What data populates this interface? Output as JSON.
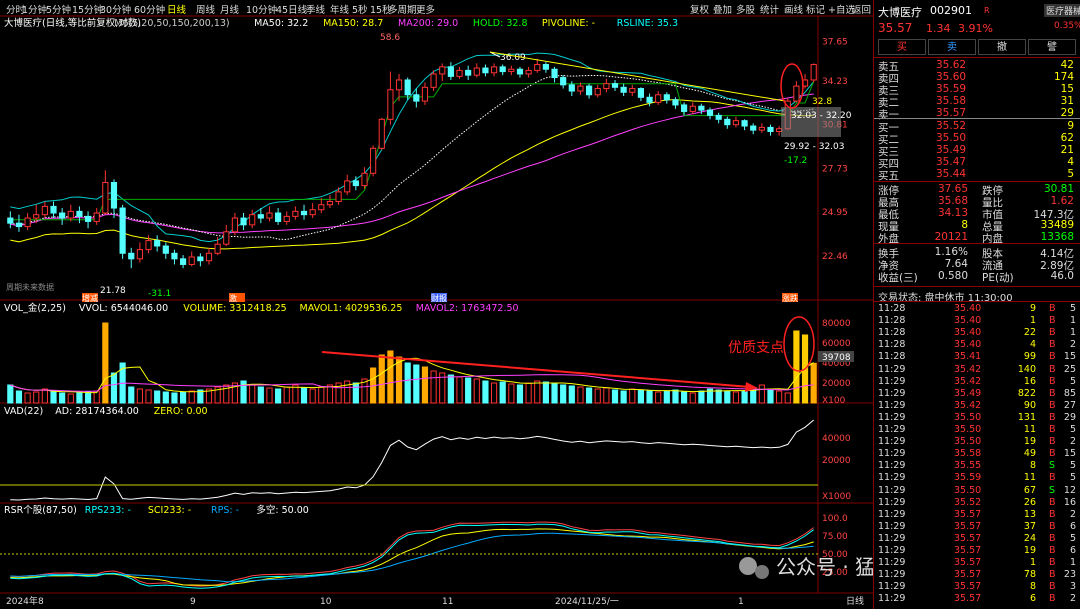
{
  "toolbar": {
    "periods": [
      "分时",
      "1分钟",
      "5分钟",
      "15分钟",
      "30分钟",
      "60分钟",
      "日线",
      "周线",
      "月线",
      "10分钟",
      "45日线",
      "季线",
      "年线",
      "5秒",
      "15秒",
      "多周期",
      "更多"
    ],
    "active_period": "日线",
    "tools": [
      "复权",
      "叠加",
      "多股",
      "统计",
      "画线",
      "标记",
      "+自选",
      "返回"
    ]
  },
  "main_panel": {
    "legend": [
      {
        "text": "大博医疗(日线,等比前复权,对数)",
        "color": "#ffffff"
      },
      {
        "text": "M6(5,20,50,150,200,13)",
        "color": "#cccccc"
      },
      {
        "text": "MA50: 32.2",
        "color": "#ffffff"
      },
      {
        "text": "MA150: 28.7",
        "color": "#ffff00"
      },
      {
        "text": "MA200: 29.0",
        "color": "#ff40ff"
      },
      {
        "text": "HOLD: 32.8",
        "color": "#00ff00"
      },
      {
        "text": "PIVOLINE: -",
        "color": "#ffff00"
      },
      {
        "text": "RSLINE: 35.3",
        "color": "#00ffff"
      }
    ],
    "price_axis": [
      "37.65",
      "34.23",
      "30.81",
      "27.73",
      "24.95",
      "22.46"
    ],
    "annotations": {
      "high": "58.6",
      "peak": "36.09",
      "low": "21.78",
      "low_mark": "-31.1",
      "hold_level": "32.8",
      "box_upper": "32.03 - 32.20",
      "box_lower": "29.92 - 32.03",
      "recent_low_mark": "-17.2",
      "note": "周期未来数据"
    },
    "event_tags": [
      "增减",
      "激",
      "财报",
      "涨跌"
    ]
  },
  "vol_panel": {
    "legend": [
      {
        "text": "VOL_金(2,25)",
        "color": "#ffffff"
      },
      {
        "text": "VVOL: 6544046.00",
        "color": "#ffffff"
      },
      {
        "text": "VOLUME: 3312418.25",
        "color": "#ffff00"
      },
      {
        "text": "MAVOL1: 4029536.25",
        "color": "#ffff00"
      },
      {
        "text": "MAVOL2: 1763472.50",
        "color": "#ff40ff"
      }
    ],
    "axis": [
      "80000",
      "60000",
      "40000",
      "20000",
      "X100"
    ],
    "current_value": "39708",
    "annotation": "优质支点"
  },
  "vad_panel": {
    "legend": [
      {
        "text": "VAD(22)",
        "color": "#ffffff"
      },
      {
        "text": "AD: 28174364.00",
        "color": "#ffffff"
      },
      {
        "text": "ZERO: 0.00",
        "color": "#ffff00"
      }
    ],
    "axis": [
      "40000",
      "20000",
      "X1000"
    ]
  },
  "rsr_panel": {
    "legend": [
      {
        "text": "RSR个股(87,50)",
        "color": "#ffffff"
      },
      {
        "text": "RPS233: -",
        "color": "#00ffff"
      },
      {
        "text": "SCI233: -",
        "color": "#ffff00"
      },
      {
        "text": "RPS: -",
        "color": "#00aaff"
      },
      {
        "text": "多空: 50.00",
        "color": "#ffffff"
      }
    ],
    "axis": [
      "100.0",
      "75.00",
      "50.00",
      "25.00"
    ]
  },
  "x_axis": {
    "labels": [
      "2024年",
      "8",
      "9",
      "10",
      "11",
      "2024/11/25/一",
      "1"
    ],
    "right_label": "日线"
  },
  "watermark": "公众号 · 猛兽派选股",
  "quote": {
    "name": "大博医疗",
    "code": "002901",
    "tag": "R",
    "sector": "医疗器械",
    "sector_change": "0.35%",
    "price": "35.57",
    "change": "1.34",
    "change_pct": "3.91%",
    "buttons": [
      "买",
      "卖",
      "撤",
      "譬"
    ],
    "asks": [
      {
        "label": "卖五",
        "price": "35.62",
        "vol": "42"
      },
      {
        "label": "卖四",
        "price": "35.60",
        "vol": "174"
      },
      {
        "label": "卖三",
        "price": "35.59",
        "vol": "15"
      },
      {
        "label": "卖二",
        "price": "35.58",
        "vol": "31"
      },
      {
        "label": "卖一",
        "price": "35.57",
        "vol": "29"
      }
    ],
    "bids": [
      {
        "label": "买一",
        "price": "35.52",
        "vol": "9"
      },
      {
        "label": "买二",
        "price": "35.50",
        "vol": "62"
      },
      {
        "label": "买三",
        "price": "35.49",
        "vol": "21"
      },
      {
        "label": "买四",
        "price": "35.47",
        "vol": "4"
      },
      {
        "label": "买五",
        "price": "35.44",
        "vol": "5"
      }
    ],
    "stats": [
      {
        "l1": "涨停",
        "v1": "37.65",
        "c1": "#ff3333",
        "l2": "跌停",
        "v2": "30.81",
        "c2": "#00ff00"
      },
      {
        "l1": "最高",
        "v1": "35.68",
        "c1": "#ff3333",
        "l2": "量比",
        "v2": "1.62",
        "c2": "#ff3333"
      },
      {
        "l1": "最低",
        "v1": "34.13",
        "c1": "#ff3333",
        "l2": "市值",
        "v2": "147.3亿",
        "c2": "#dddddd"
      },
      {
        "l1": "现量",
        "v1": "8",
        "c1": "#ffff00",
        "l2": "总量",
        "v2": "33489",
        "c2": "#ffff00"
      },
      {
        "l1": "外盘",
        "v1": "20121",
        "c1": "#ff3333",
        "l2": "内盘",
        "v2": "13368",
        "c2": "#00ff00"
      }
    ],
    "stats2": [
      {
        "l1": "换手",
        "v1": "1.16%",
        "l2": "股本",
        "v2": "4.14亿"
      },
      {
        "l1": "净资",
        "v1": "7.64",
        "l2": "流通",
        "v2": "2.89亿"
      },
      {
        "l1": "收益(三)",
        "v1": "0.580",
        "l2": "PE(动)",
        "v2": "46.0"
      }
    ],
    "status": "交易状态: 盘中休市 11:30:00"
  },
  "ticks": [
    {
      "t": "11:28",
      "p": "35.40",
      "v": "9",
      "s": "B",
      "n": "5"
    },
    {
      "t": "11:28",
      "p": "35.40",
      "v": "1",
      "s": "B",
      "n": "1"
    },
    {
      "t": "11:28",
      "p": "35.40",
      "v": "22",
      "s": "B",
      "n": "1"
    },
    {
      "t": "11:28",
      "p": "35.40",
      "v": "4",
      "s": "B",
      "n": "2"
    },
    {
      "t": "11:28",
      "p": "35.41",
      "v": "99",
      "s": "B",
      "n": "15"
    },
    {
      "t": "11:29",
      "p": "35.42",
      "v": "140",
      "s": "B",
      "n": "25"
    },
    {
      "t": "11:29",
      "p": "35.42",
      "v": "16",
      "s": "B",
      "n": "5"
    },
    {
      "t": "11:29",
      "p": "35.49",
      "v": "822",
      "s": "B",
      "n": "85"
    },
    {
      "t": "11:29",
      "p": "35.42",
      "v": "90",
      "s": "B",
      "n": "27"
    },
    {
      "t": "11:29",
      "p": "35.50",
      "v": "131",
      "s": "B",
      "n": "29"
    },
    {
      "t": "11:29",
      "p": "35.50",
      "v": "11",
      "s": "B",
      "n": "5"
    },
    {
      "t": "11:29",
      "p": "35.50",
      "v": "19",
      "s": "B",
      "n": "2"
    },
    {
      "t": "11:29",
      "p": "35.58",
      "v": "49",
      "s": "B",
      "n": "15"
    },
    {
      "t": "11:29",
      "p": "35.55",
      "v": "8",
      "s": "S",
      "n": "5"
    },
    {
      "t": "11:29",
      "p": "35.59",
      "v": "11",
      "s": "B",
      "n": "5"
    },
    {
      "t": "11:29",
      "p": "35.50",
      "v": "67",
      "s": "S",
      "n": "12"
    },
    {
      "t": "11:29",
      "p": "35.52",
      "v": "26",
      "s": "B",
      "n": "16"
    },
    {
      "t": "11:29",
      "p": "35.57",
      "v": "13",
      "s": "B",
      "n": "2"
    },
    {
      "t": "11:29",
      "p": "35.57",
      "v": "37",
      "s": "B",
      "n": "6"
    },
    {
      "t": "11:29",
      "p": "35.57",
      "v": "24",
      "s": "B",
      "n": "5"
    },
    {
      "t": "11:29",
      "p": "35.57",
      "v": "19",
      "s": "B",
      "n": "6"
    },
    {
      "t": "11:29",
      "p": "35.57",
      "v": "1",
      "s": "B",
      "n": "1"
    },
    {
      "t": "11:29",
      "p": "35.57",
      "v": "78",
      "s": "B",
      "n": "23"
    },
    {
      "t": "11:29",
      "p": "35.57",
      "v": "8",
      "s": "B",
      "n": "3"
    },
    {
      "t": "11:29",
      "p": "35.57",
      "v": "6",
      "s": "B",
      "n": "2"
    }
  ],
  "chart_data": {
    "type": "candlestick",
    "title": "大博医疗(日线,等比前复权,对数)",
    "x_labels": [
      "2024年",
      "8",
      "9",
      "10",
      "11",
      "2024/11/25/一",
      "1"
    ],
    "y_axis_ticks": [
      37.65,
      34.23,
      30.81,
      27.73,
      24.95,
      22.46
    ],
    "ylim": [
      21.5,
      38.5
    ],
    "candles_ohlc": [
      [
        24.6,
        24.3,
        25.0,
        24.0
      ],
      [
        24.3,
        24.1,
        24.8,
        23.8
      ],
      [
        24.1,
        24.6,
        24.9,
        23.9
      ],
      [
        24.6,
        24.8,
        25.4,
        24.3
      ],
      [
        24.8,
        25.3,
        25.6,
        24.6
      ],
      [
        25.3,
        24.9,
        25.6,
        24.6
      ],
      [
        24.9,
        24.6,
        25.2,
        24.2
      ],
      [
        24.6,
        25.0,
        25.4,
        24.4
      ],
      [
        25.0,
        24.7,
        25.3,
        24.3
      ],
      [
        24.7,
        24.4,
        25.0,
        24.0
      ],
      [
        24.4,
        24.9,
        25.2,
        24.2
      ],
      [
        24.9,
        26.8,
        27.6,
        24.8
      ],
      [
        26.8,
        25.2,
        27.0,
        24.6
      ],
      [
        25.2,
        22.6,
        25.4,
        22.3
      ],
      [
        22.6,
        22.3,
        22.9,
        21.8
      ],
      [
        22.3,
        22.8,
        23.2,
        22.1
      ],
      [
        22.8,
        23.3,
        23.6,
        22.6
      ],
      [
        23.3,
        23.0,
        23.6,
        22.7
      ],
      [
        23.0,
        22.6,
        23.2,
        22.3
      ],
      [
        22.6,
        22.3,
        22.8,
        22.0
      ],
      [
        22.3,
        22.0,
        22.5,
        21.8
      ],
      [
        22.0,
        22.4,
        22.7,
        21.9
      ],
      [
        22.4,
        22.2,
        22.6,
        21.9
      ],
      [
        22.2,
        22.6,
        22.9,
        22.0
      ],
      [
        22.6,
        23.1,
        23.5,
        22.5
      ],
      [
        23.1,
        23.8,
        24.2,
        23.0
      ],
      [
        23.8,
        24.6,
        24.9,
        23.6
      ],
      [
        24.6,
        24.2,
        24.9,
        23.9
      ],
      [
        24.2,
        24.8,
        25.1,
        24.0
      ],
      [
        24.8,
        24.6,
        25.2,
        24.3
      ],
      [
        24.6,
        24.9,
        25.3,
        24.4
      ],
      [
        24.9,
        24.4,
        25.2,
        24.2
      ],
      [
        24.4,
        24.7,
        25.0,
        24.2
      ],
      [
        24.7,
        25.0,
        25.3,
        24.5
      ],
      [
        25.0,
        24.8,
        25.4,
        24.5
      ],
      [
        24.8,
        25.1,
        25.5,
        24.6
      ],
      [
        25.1,
        25.4,
        25.8,
        24.9
      ],
      [
        25.4,
        25.6,
        26.0,
        25.2
      ],
      [
        25.6,
        26.2,
        26.5,
        25.4
      ],
      [
        26.2,
        26.9,
        27.3,
        26.0
      ],
      [
        26.9,
        26.6,
        27.2,
        26.3
      ],
      [
        26.6,
        27.4,
        27.8,
        26.4
      ],
      [
        27.4,
        29.1,
        29.3,
        27.2
      ],
      [
        29.1,
        31.2,
        31.3,
        29.0
      ],
      [
        31.2,
        33.5,
        35.0,
        30.8
      ],
      [
        33.5,
        34.3,
        34.8,
        32.6
      ],
      [
        34.3,
        33.1,
        34.5,
        32.7
      ],
      [
        33.1,
        32.6,
        33.6,
        32.1
      ],
      [
        32.6,
        33.7,
        34.1,
        32.3
      ],
      [
        33.7,
        34.8,
        35.1,
        33.4
      ],
      [
        34.8,
        35.4,
        35.7,
        34.2
      ],
      [
        35.4,
        34.6,
        35.8,
        34.3
      ],
      [
        34.6,
        35.1,
        35.4,
        34.4
      ],
      [
        35.1,
        34.7,
        35.5,
        34.3
      ],
      [
        34.7,
        35.3,
        35.7,
        34.5
      ],
      [
        35.3,
        34.9,
        35.6,
        34.6
      ],
      [
        34.9,
        35.4,
        35.7,
        34.6
      ],
      [
        35.4,
        35.0,
        35.6,
        34.7
      ],
      [
        35.0,
        35.2,
        35.5,
        34.7
      ],
      [
        35.2,
        34.8,
        35.4,
        34.5
      ],
      [
        34.8,
        35.1,
        35.4,
        34.5
      ],
      [
        35.1,
        35.6,
        36.1,
        34.9
      ],
      [
        35.6,
        35.2,
        35.8,
        34.9
      ],
      [
        35.2,
        34.5,
        35.4,
        34.1
      ],
      [
        34.5,
        33.9,
        34.7,
        33.6
      ],
      [
        33.9,
        33.4,
        34.2,
        33.0
      ],
      [
        33.4,
        33.8,
        34.1,
        33.1
      ],
      [
        33.8,
        33.1,
        34.0,
        32.8
      ],
      [
        33.1,
        33.6,
        33.9,
        32.9
      ],
      [
        33.6,
        34.0,
        34.4,
        33.3
      ],
      [
        34.0,
        33.7,
        34.3,
        33.4
      ],
      [
        33.7,
        33.3,
        34.0,
        33.0
      ],
      [
        33.3,
        33.6,
        33.9,
        33.0
      ],
      [
        33.6,
        32.9,
        33.7,
        32.6
      ],
      [
        32.9,
        32.5,
        33.2,
        32.2
      ],
      [
        32.5,
        33.1,
        33.4,
        32.3
      ],
      [
        33.1,
        32.7,
        33.3,
        32.4
      ],
      [
        32.7,
        32.3,
        32.9,
        32.0
      ],
      [
        32.3,
        31.8,
        32.5,
        31.5
      ],
      [
        31.8,
        32.2,
        32.5,
        31.6
      ],
      [
        32.2,
        31.9,
        32.4,
        31.6
      ],
      [
        31.9,
        31.5,
        32.1,
        31.2
      ],
      [
        31.5,
        31.2,
        31.7,
        30.9
      ],
      [
        31.2,
        30.8,
        31.4,
        30.5
      ],
      [
        30.8,
        31.1,
        31.4,
        30.6
      ],
      [
        31.1,
        30.7,
        31.2,
        30.4
      ],
      [
        30.7,
        30.4,
        30.9,
        30.1
      ],
      [
        30.4,
        30.6,
        30.9,
        30.2
      ],
      [
        30.6,
        30.3,
        30.8,
        30.0
      ],
      [
        30.3,
        30.5,
        30.7,
        30.0
      ],
      [
        30.5,
        32.6,
        32.8,
        30.4
      ],
      [
        32.6,
        33.8,
        34.2,
        32.5
      ],
      [
        33.8,
        34.3,
        34.8,
        33.6
      ],
      [
        34.3,
        35.6,
        35.7,
        34.1
      ]
    ],
    "volume_units": "X100",
    "volumes": [
      18000,
      12000,
      10000,
      11000,
      14000,
      12000,
      10000,
      9000,
      10000,
      11000,
      12000,
      80000,
      30000,
      40000,
      16000,
      14000,
      13000,
      12000,
      11000,
      10000,
      11000,
      12000,
      13000,
      14000,
      16000,
      18000,
      20000,
      22000,
      18000,
      16000,
      15000,
      14000,
      16000,
      18000,
      15000,
      14000,
      16000,
      18000,
      20000,
      22000,
      20000,
      24000,
      35000,
      48000,
      52000,
      46000,
      40000,
      38000,
      36000,
      32000,
      30000,
      28000,
      26000,
      25000,
      24000,
      22000,
      20000,
      21000,
      19000,
      18000,
      20000,
      22000,
      21000,
      19000,
      18000,
      17000,
      16000,
      15000,
      14000,
      15000,
      13000,
      12000,
      14000,
      13000,
      12000,
      11000,
      12000,
      13000,
      11000,
      10000,
      12000,
      14000,
      13000,
      12000,
      11000,
      12000,
      15000,
      18000,
      14000,
      12000,
      10000,
      72000,
      68000,
      39708
    ],
    "series": [
      {
        "name": "MA50",
        "color": "#ffffff",
        "last": 32.2
      },
      {
        "name": "MA150",
        "color": "#ffff00",
        "last": 28.7
      },
      {
        "name": "MA200",
        "color": "#ff40ff",
        "last": 29.0
      },
      {
        "name": "HOLD",
        "color": "#00ff00",
        "last": 32.8
      },
      {
        "name": "RSLINE",
        "color": "#00ffff",
        "last": 35.3
      }
    ]
  }
}
